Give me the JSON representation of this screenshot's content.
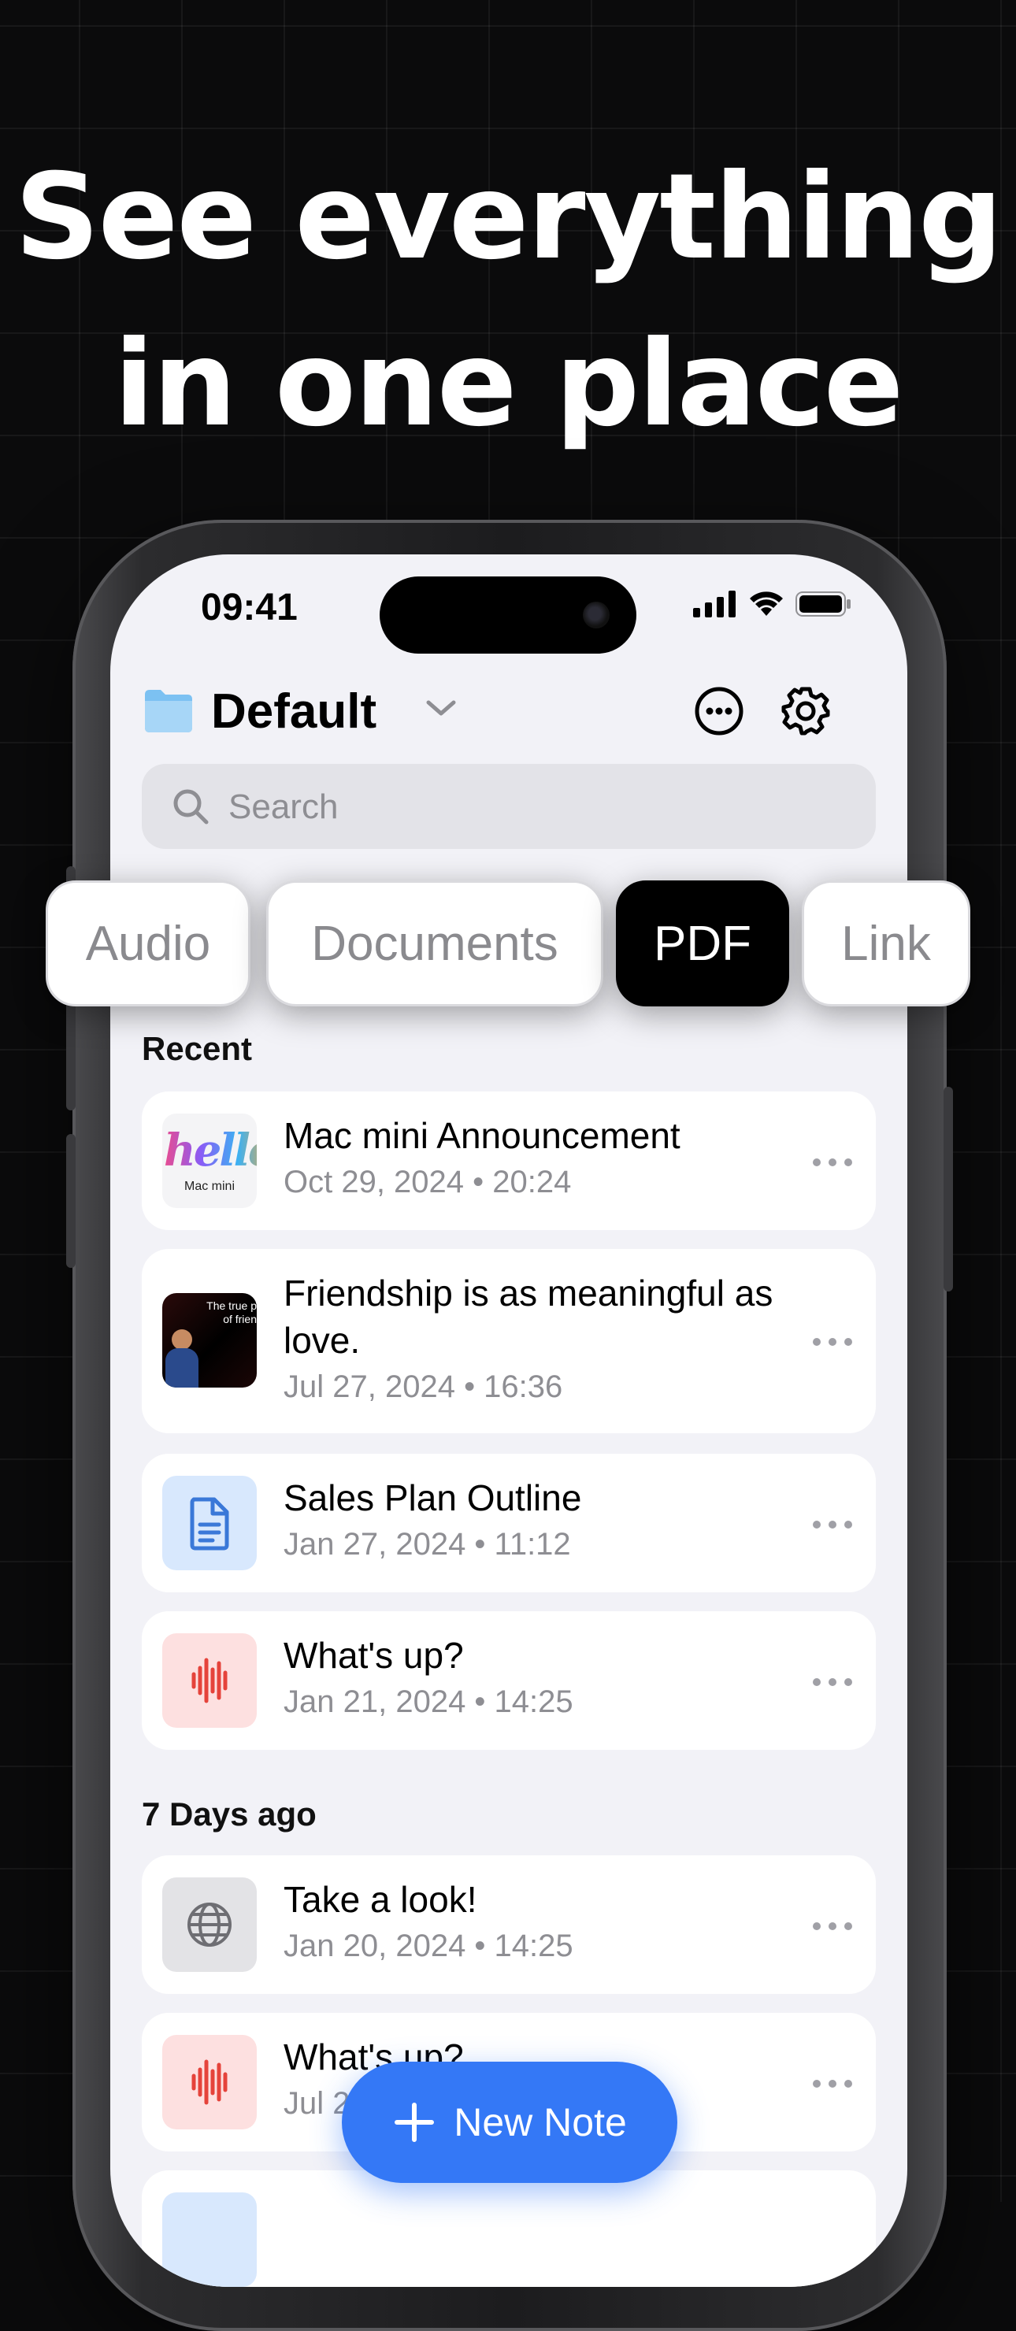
{
  "headline": {
    "line1": "See everything",
    "line2": "in one place"
  },
  "status_bar": {
    "time": "09:41"
  },
  "header": {
    "folder_name": "Default"
  },
  "search": {
    "placeholder": "Search"
  },
  "tabs": [
    {
      "label": "Audio",
      "active": false
    },
    {
      "label": "Documents",
      "active": false
    },
    {
      "label": "PDF",
      "active": true
    },
    {
      "label": "Link",
      "active": false
    }
  ],
  "sections": {
    "recent": "Recent",
    "seven_days": "7 Days ago"
  },
  "thumb_text": {
    "mac_mini_logo": "hello",
    "mac_mini_caption": "Mac mini",
    "friendship_caption_1": "The true p",
    "friendship_caption_2": "of frien"
  },
  "notes": [
    {
      "title": "Mac mini Announcement",
      "date": "Oct 29, 2024 • 20:24",
      "thumb": "image-mac-mini"
    },
    {
      "title": "Friendship is as meaningful as love.",
      "date": "Jul 27, 2024 • 16:36",
      "thumb": "video-friendship"
    },
    {
      "title": "Sales Plan Outline",
      "date": "Jan 27, 2024 • 11:12",
      "thumb": "document-icon"
    },
    {
      "title": "What's up?",
      "date": "Jan 21, 2024 • 14:25",
      "thumb": "waveform-icon"
    },
    {
      "title": "Take a look!",
      "date": "Jan 20, 2024 • 14:25",
      "thumb": "globe-icon"
    },
    {
      "title": "What's up?",
      "date": "Jul 2",
      "thumb": "waveform-icon"
    }
  ],
  "fab": {
    "label": "New Note"
  },
  "colors": {
    "accent": "#3478f6",
    "folder": "#7cc1f2",
    "audio_tint": "#fde0e0",
    "audio_red": "#e5433b",
    "doc_tint": "#d8e8fd",
    "doc_blue": "#3a78d8"
  }
}
